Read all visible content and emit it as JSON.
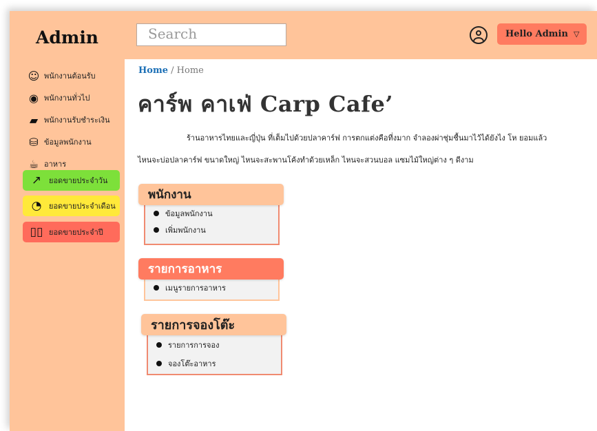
{
  "app": {
    "title": "Admin"
  },
  "search": {
    "placeholder": "Search"
  },
  "user": {
    "greeting": "Hello Admin",
    "caret": "▽"
  },
  "sidebar": {
    "items": [
      {
        "label": "พนักงานต้อนรับ",
        "icon": "smiley-icon"
      },
      {
        "label": "พนักงานทั่วไป",
        "icon": "user-circle-icon"
      },
      {
        "label": "พนักงานรับชำระเงิน",
        "icon": "wallet-icon"
      },
      {
        "label": "ข้อมูลพนักงาน",
        "icon": "database-icon"
      },
      {
        "label": "อาหาร",
        "icon": "mug-icon"
      }
    ],
    "sales": [
      {
        "label": "ยอดขายประจำวัน",
        "icon": "trend-up-icon",
        "color": "#7de03a"
      },
      {
        "label": "ยอดขายประจำเดือน",
        "icon": "pie-chart-icon",
        "color": "#ffe93a"
      },
      {
        "label": "ยอดขายประจำปี",
        "icon": "book-icon",
        "color": "#ff6b5b"
      }
    ]
  },
  "breadcrumb": {
    "home": "Home",
    "separator": "/",
    "current": "Home"
  },
  "main": {
    "title": "คาร์พ คาเฟ่ Carp Cafe’",
    "description_line1": "ร้านอาหารไทยและญี่ปุ่น ที่เต็มไปด้วยปลาคาร์ฟ การตกแต่งคือที่งมาก จำลองผ่าชุ่มชื้นมาไว้ได้ยังไง โห ยอมแล้ว",
    "description_line2": "ไหนจะบ่อปลาคาร์ฟ ขนาดใหญ่ ไหนจะสะพานโค้งทำด้วยเหล็ก ไหนจะสวนบอล แซมไม้ใหญ่ต่าง ๆ ดีงาม"
  },
  "cards": [
    {
      "title": "พนักงาน",
      "color": "#ffc49a",
      "border": "#f08a70",
      "items": [
        "ข้อมูลพนักงาน",
        "เพิ่มพนักงาน"
      ]
    },
    {
      "title": "รายการอาหาร",
      "color": "#ff7b60",
      "border": "#ffc49a",
      "items": [
        "เมนูรายการอาหาร"
      ]
    },
    {
      "title": "รายการจองโต๊ะ",
      "color": "#ffc49a",
      "border": "#f08a70",
      "items": [
        "รายการการจอง",
        "จองโต๊ะอาหาร"
      ]
    }
  ]
}
